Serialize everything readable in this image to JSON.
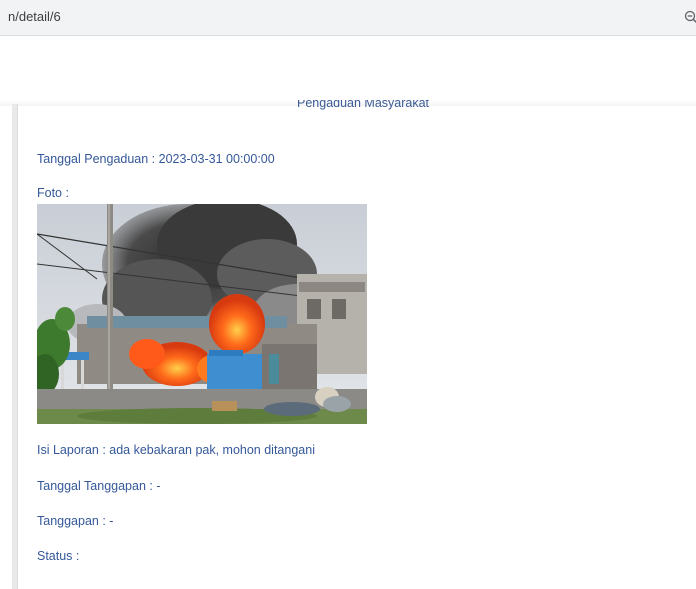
{
  "browser": {
    "url": "n/detail/6",
    "zoom_icon": "zoom-out-icon"
  },
  "page": {
    "title": "Pengaduan Masyarakat",
    "tanggal_pengaduan": "Tanggal Pengaduan : 2023-03-31 00:00:00",
    "foto_label": "Foto :",
    "photo_subject": "house-fire-photo",
    "isi_laporan": "Isi Laporan : ada kebakaran pak, mohon ditangani",
    "tanggal_tanggapan": "Tanggal Tanggapan : -",
    "tanggapan": "Tanggapan : -",
    "status": "Status :"
  },
  "colors": {
    "text_blue": "#35589a",
    "address_bar": "#f1f3f4"
  }
}
